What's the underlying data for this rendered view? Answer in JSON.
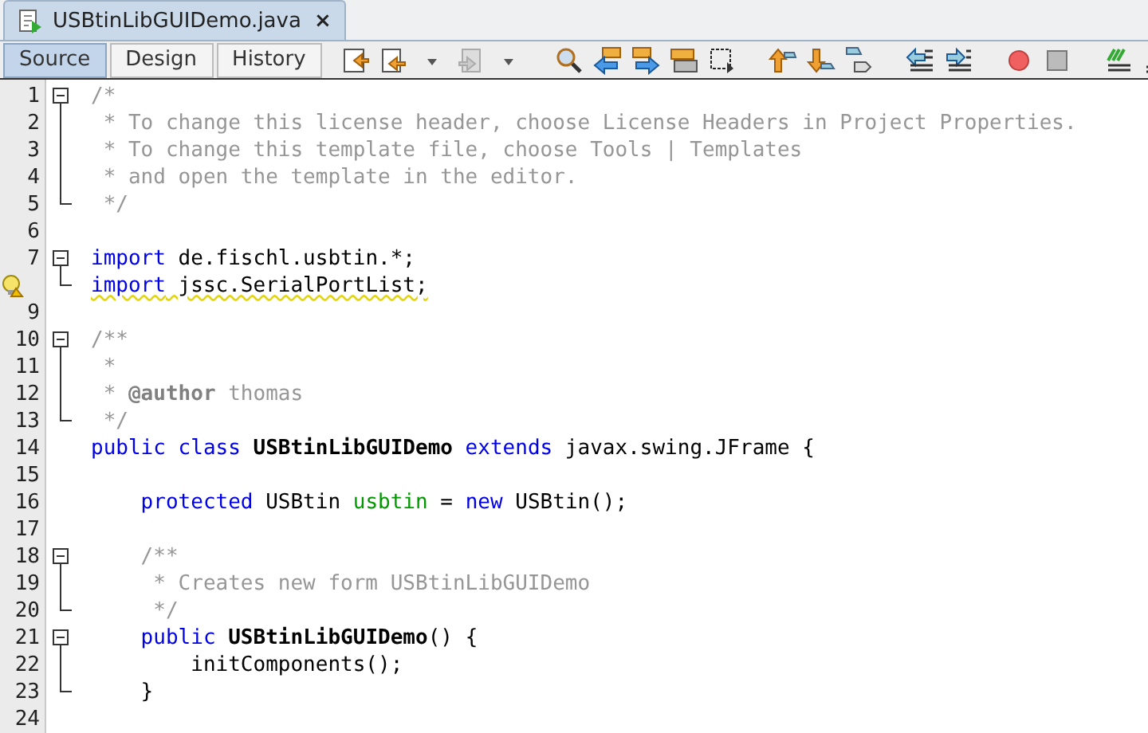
{
  "file_tab": {
    "title": "USBtinLibGUIDemo.java",
    "close": "×"
  },
  "view_tabs": [
    {
      "label": "Source",
      "selected": true
    },
    {
      "label": "Design",
      "selected": false
    },
    {
      "label": "History",
      "selected": false
    }
  ],
  "lines": [
    {
      "number": "1",
      "kind": "fold-start",
      "warning": false,
      "tokens": [
        {
          "kind": "comment",
          "text": "/*"
        }
      ]
    },
    {
      "number": "2",
      "kind": "fold-mid",
      "warning": false,
      "tokens": [
        {
          "kind": "comment",
          "text": " * To change this license header, choose License Headers in Project Properties."
        }
      ]
    },
    {
      "number": "3",
      "kind": "fold-mid",
      "warning": false,
      "tokens": [
        {
          "kind": "comment",
          "text": " * To change this template file, choose Tools | Templates"
        }
      ]
    },
    {
      "number": "4",
      "kind": "fold-mid",
      "warning": false,
      "tokens": [
        {
          "kind": "comment",
          "text": " * and open the template in the editor."
        }
      ]
    },
    {
      "number": "5",
      "kind": "fold-end",
      "warning": false,
      "tokens": [
        {
          "kind": "comment",
          "text": " */"
        }
      ]
    },
    {
      "number": "6",
      "kind": "plain"
    },
    {
      "number": "7",
      "kind": "fold-start",
      "warning": false,
      "tokens": [
        {
          "kind": "keyword",
          "text": "import"
        },
        {
          "kind": "plain",
          "text": " de.fischl.usbtin.*;"
        }
      ]
    },
    {
      "kind": "fold-end",
      "warning": true,
      "tokens": [
        {
          "kind": "keyword",
          "text": "import"
        },
        {
          "kind": "plain",
          "text": " jssc.SerialPortList;"
        }
      ]
    },
    {
      "number": "9",
      "kind": "plain"
    },
    {
      "number": "10",
      "kind": "fold-start",
      "warning": false,
      "tokens": [
        {
          "kind": "comment",
          "text": "/**"
        }
      ]
    },
    {
      "number": "11",
      "kind": "fold-mid",
      "warning": false,
      "tokens": [
        {
          "kind": "comment",
          "text": " *"
        }
      ]
    },
    {
      "number": "12",
      "kind": "fold-mid",
      "warning": false,
      "tokens": [
        {
          "kind": "comment",
          "text": " * "
        },
        {
          "kind": "tag",
          "text": "@author"
        },
        {
          "kind": "comment",
          "text": " thomas"
        }
      ]
    },
    {
      "number": "13",
      "kind": "fold-end",
      "warning": false,
      "tokens": [
        {
          "kind": "comment",
          "text": " */"
        }
      ]
    },
    {
      "number": "14",
      "kind": "plain",
      "warning": false,
      "tokens": [
        {
          "kind": "keyword",
          "text": "public class"
        },
        {
          "kind": "bold",
          "text": " USBtinLibGUIDemo"
        },
        {
          "kind": "keyword",
          "text": " extends"
        },
        {
          "kind": "plain",
          "text": " javax.swing.JFrame {"
        }
      ]
    },
    {
      "number": "15",
      "kind": "plain"
    },
    {
      "number": "16",
      "kind": "plain",
      "warning": false,
      "tokens": [
        {
          "kind": "keyword",
          "text": "    protected"
        },
        {
          "kind": "plain",
          "text": " USBtin "
        },
        {
          "kind": "field",
          "text": "usbtin"
        },
        {
          "kind": "plain",
          "text": " = "
        },
        {
          "kind": "keyword",
          "text": "new"
        },
        {
          "kind": "plain",
          "text": " USBtin();"
        }
      ]
    },
    {
      "number": "17",
      "kind": "plain"
    },
    {
      "number": "18",
      "kind": "fold-start",
      "warning": false,
      "tokens": [
        {
          "kind": "comment",
          "text": "    /**"
        }
      ]
    },
    {
      "number": "19",
      "kind": "fold-mid",
      "warning": false,
      "tokens": [
        {
          "kind": "comment",
          "text": "     * Creates new form USBtinLibGUIDemo"
        }
      ]
    },
    {
      "number": "20",
      "kind": "fold-end",
      "warning": false,
      "tokens": [
        {
          "kind": "comment",
          "text": "     */"
        }
      ]
    },
    {
      "number": "21",
      "kind": "fold-start",
      "warning": false,
      "tokens": [
        {
          "kind": "keyword",
          "text": "    public"
        },
        {
          "kind": "bold",
          "text": " USBtinLibGUIDemo"
        },
        {
          "kind": "plain",
          "text": "() {"
        }
      ]
    },
    {
      "number": "22",
      "kind": "fold-mid",
      "warning": false,
      "tokens": [
        {
          "kind": "plain",
          "text": "        initComponents();"
        }
      ]
    },
    {
      "number": "23",
      "kind": "fold-end",
      "warning": false,
      "tokens": [
        {
          "kind": "plain",
          "text": "    }"
        }
      ]
    },
    {
      "number": "24",
      "kind": "plain"
    }
  ]
}
